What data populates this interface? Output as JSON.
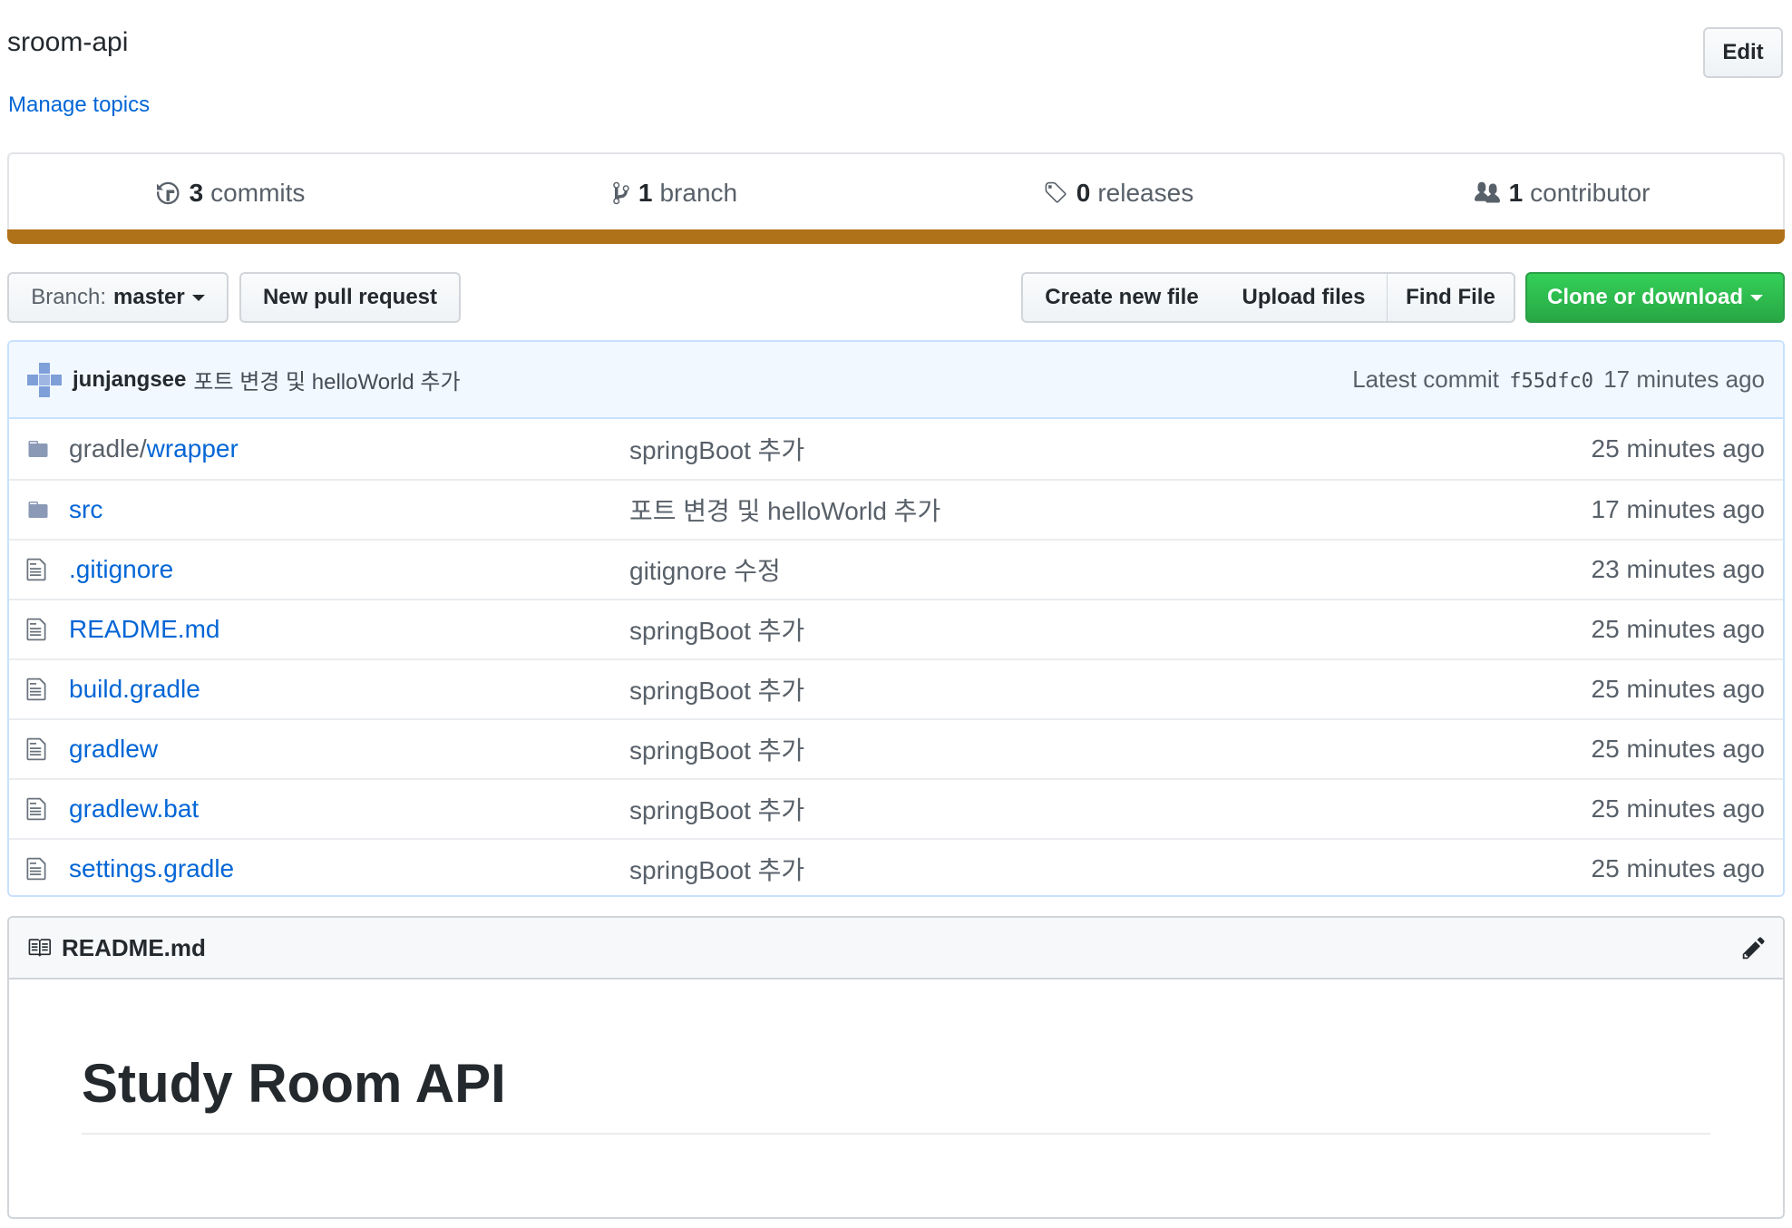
{
  "repo": {
    "description": "sroom-api",
    "manage_topics": "Manage topics",
    "edit_label": "Edit"
  },
  "numbers_summary": {
    "commits": {
      "count": "3",
      "label": "commits",
      "icon": "history-icon"
    },
    "branches": {
      "count": "1",
      "label": "branch",
      "icon": "git-branch-icon"
    },
    "releases": {
      "count": "0",
      "label": "releases",
      "icon": "tag-icon"
    },
    "contributors": {
      "count": "1",
      "label": "contributor",
      "icon": "people-icon"
    },
    "language_color": "#b07219"
  },
  "toolbar": {
    "branch_prefix": "Branch:",
    "branch_name": "master",
    "new_pull_request": "New pull request",
    "create_new_file": "Create new file",
    "upload_files": "Upload files",
    "find_file": "Find File",
    "clone_or_download": "Clone or download"
  },
  "latest_commit": {
    "author": "junjangsee",
    "message": "포트 변경 및 helloWorld 추가",
    "label": "Latest commit",
    "sha": "f55dfc0",
    "age": "17 minutes ago"
  },
  "files": [
    {
      "type": "dir",
      "prefix": "gradle/",
      "name": "wrapper",
      "message": "springBoot 추가",
      "age": "25 minutes ago"
    },
    {
      "type": "dir",
      "prefix": "",
      "name": "src",
      "message": "포트 변경 및 helloWorld 추가",
      "age": "17 minutes ago"
    },
    {
      "type": "file",
      "prefix": "",
      "name": ".gitignore",
      "message": "gitignore 수정",
      "age": "23 minutes ago"
    },
    {
      "type": "file",
      "prefix": "",
      "name": "README.md",
      "message": "springBoot 추가",
      "age": "25 minutes ago"
    },
    {
      "type": "file",
      "prefix": "",
      "name": "build.gradle",
      "message": "springBoot 추가",
      "age": "25 minutes ago"
    },
    {
      "type": "file",
      "prefix": "",
      "name": "gradlew",
      "message": "springBoot 추가",
      "age": "25 minutes ago"
    },
    {
      "type": "file",
      "prefix": "",
      "name": "gradlew.bat",
      "message": "springBoot 추가",
      "age": "25 minutes ago"
    },
    {
      "type": "file",
      "prefix": "",
      "name": "settings.gradle",
      "message": "springBoot 추가",
      "age": "25 minutes ago"
    }
  ],
  "readme": {
    "filename": "README.md",
    "heading": "Study Room API"
  }
}
